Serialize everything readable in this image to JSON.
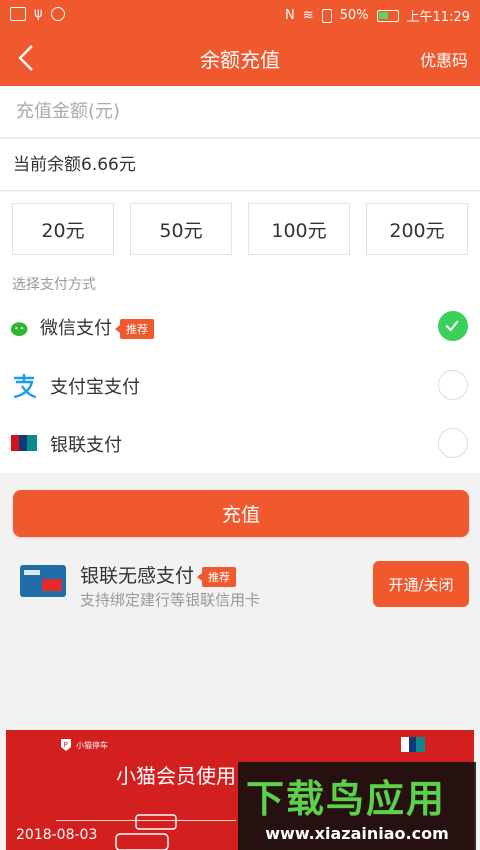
{
  "status_bar": {
    "battery": "50%",
    "time": "上午11:29"
  },
  "nav": {
    "title": "余额充值",
    "right_action": "优惠码"
  },
  "amount_input": {
    "placeholder": "充值金额(元)",
    "value": ""
  },
  "balance_text": "当前余额6.66元",
  "amount_options": [
    "20元",
    "50元",
    "100元",
    "200元"
  ],
  "payment": {
    "section_label": "选择支付方式",
    "methods": [
      {
        "label": "微信支付",
        "tag": "推荐",
        "checked": true,
        "icon": "wechat-pay-icon"
      },
      {
        "label": "支付宝支付",
        "tag": "",
        "checked": false,
        "icon": "alipay-icon"
      },
      {
        "label": "银联支付",
        "tag": "",
        "checked": false,
        "icon": "unionpay-icon"
      }
    ]
  },
  "recharge_button": "充值",
  "unionpay_seamless": {
    "title": "银联无感支付",
    "tag": "推荐",
    "subtitle": "支持绑定建行等银联信用卡",
    "button": "开通/关闭"
  },
  "banner": {
    "brand": "小猫停车",
    "title": "小猫会员使用",
    "date": "2018-08-03"
  },
  "watermark": {
    "title": "下载鸟应用",
    "url": "www.xiazainiao.com"
  },
  "colors": {
    "primary": "#f0592d",
    "check_green": "#3ccf5a",
    "banner_red": "#d3201f",
    "watermark_green": "#5bd24a"
  }
}
